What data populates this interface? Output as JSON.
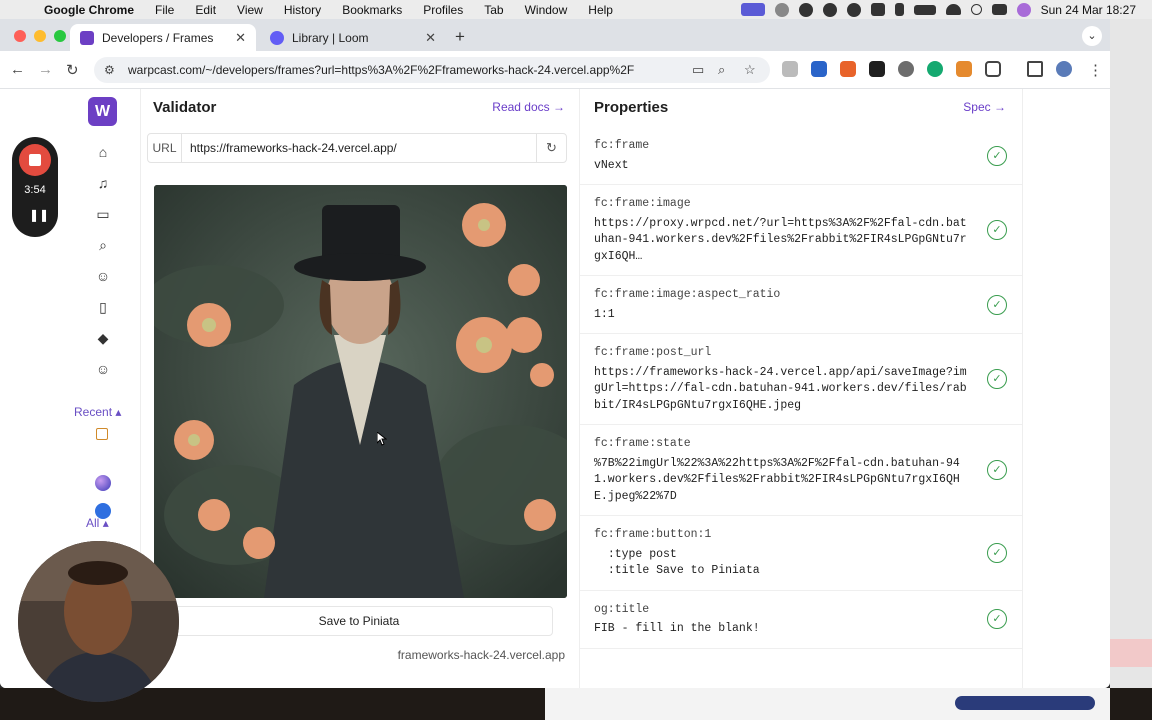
{
  "menubar": {
    "app": "Google Chrome",
    "items": [
      "File",
      "Edit",
      "View",
      "History",
      "Bookmarks",
      "Profiles",
      "Tab",
      "Window",
      "Help"
    ],
    "clock": "Sun 24 Mar  18:27"
  },
  "tabs": [
    {
      "title": "Developers / Frames",
      "active": true
    },
    {
      "title": "Library | Loom",
      "active": false
    }
  ],
  "address": "warpcast.com/~/developers/frames?url=https%3A%2F%2Fframeworks-hack-24.vercel.app%2F",
  "sidebar": {
    "logo": "W",
    "recent_label": "Recent",
    "all_label": "All"
  },
  "validator": {
    "title": "Validator",
    "read_docs": "Read docs",
    "url_label": "URL",
    "url_value": "https://frameworks-hack-24.vercel.app/",
    "button_label": "Save to Piniata",
    "domain": "frameworks-hack-24.vercel.app"
  },
  "properties": {
    "title": "Properties",
    "spec": "Spec",
    "items": [
      {
        "key": "fc:frame",
        "value": "vNext"
      },
      {
        "key": "fc:frame:image",
        "value": "https://proxy.wrpcd.net/?url=https%3A%2F%2Ffal-cdn.batuhan-941.workers.dev%2Ffiles%2Frabbit%2FIR4sLPGpGNtu7rgxI6QH…"
      },
      {
        "key": "fc:frame:image:aspect_ratio",
        "value": "1:1"
      },
      {
        "key": "fc:frame:post_url",
        "value": "https://frameworks-hack-24.vercel.app/api/saveImage?imgUrl=https://fal-cdn.batuhan-941.workers.dev/files/rabbit/IR4sLPGpGNtu7rgxI6QHE.jpeg"
      },
      {
        "key": "fc:frame:state",
        "value": "%7B%22imgUrl%22%3A%22https%3A%2F%2Ffal-cdn.batuhan-941.workers.dev%2Ffiles%2Frabbit%2FIR4sLPGpGNtu7rgxI6QHE.jpeg%22%7D"
      },
      {
        "key": "fc:frame:button:1",
        "value": "  :type post\n  :title Save to Piniata"
      },
      {
        "key": "og:title",
        "value": "FIB - fill in the blank!"
      }
    ]
  },
  "loom": {
    "timer": "3:54"
  },
  "colors": {
    "accent": "#6a3ec9",
    "valid": "#3a9d4f",
    "record": "#e34b3f"
  }
}
